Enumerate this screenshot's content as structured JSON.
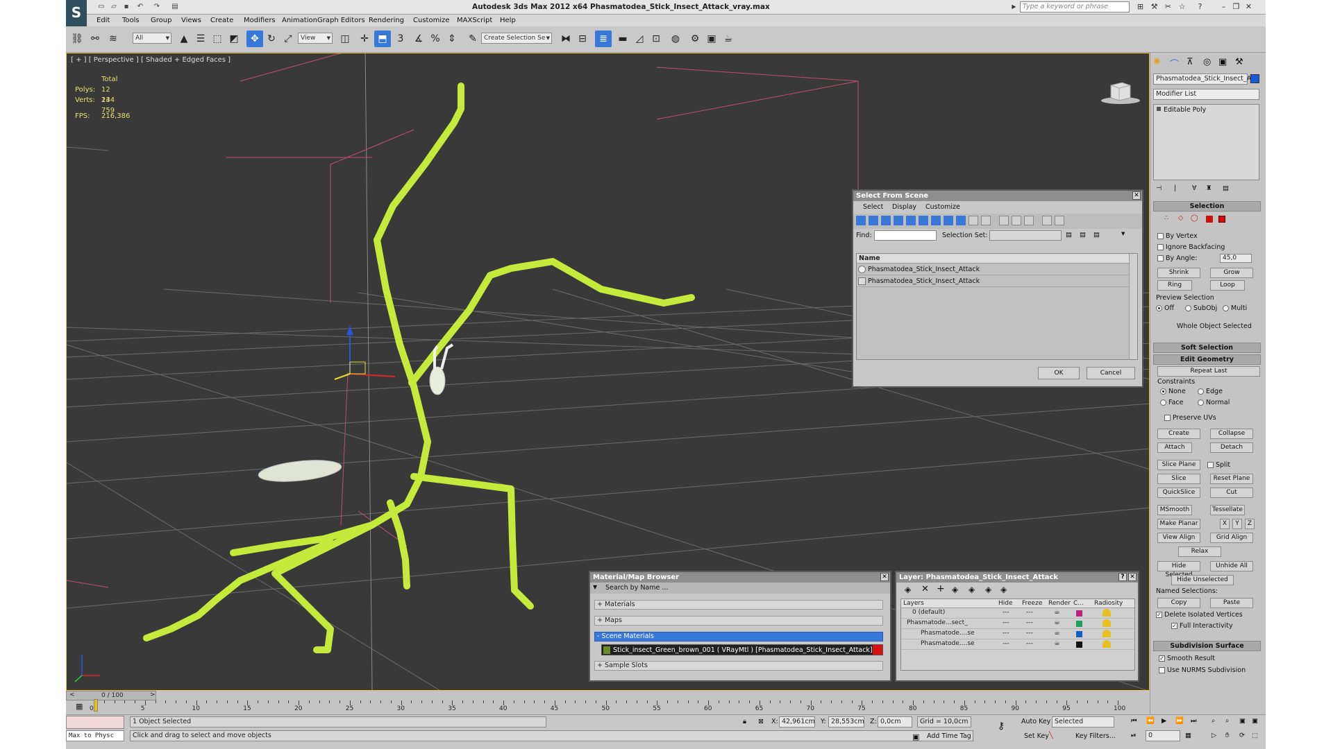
{
  "app": {
    "title": "Autodesk 3ds Max  2012 x64     Phasmatodea_Stick_Insect_Attack_vray.max",
    "search_placeholder": "Type a keyword or phrase"
  },
  "menu": [
    "Edit",
    "Tools",
    "Group",
    "Views",
    "Create",
    "Modifiers",
    "Animation",
    "Graph Editors",
    "Rendering",
    "Customize",
    "MAXScript",
    "Help"
  ],
  "toolbar": {
    "filter": "All",
    "ref_coord": "View",
    "selection_set": "Create Selection Se"
  },
  "viewport": {
    "label": "[ + ] [ Perspective ] [ Shaded + Edged Faces ]",
    "stats": {
      "header": "Total",
      "polys_label": "Polys:",
      "polys": "12 244",
      "verts_label": "Verts:",
      "verts": "13 759",
      "fps_label": "FPS:",
      "fps": "216,386"
    }
  },
  "command_panel": {
    "object_name": "Phasmatodea_Stick_Insect_A",
    "modifier_list": "Modifier List",
    "stack_item": "Editable Poly",
    "selection": {
      "title": "Selection",
      "by_vertex": "By Vertex",
      "ignore_backfacing": "Ignore Backfacing",
      "by_angle": "By Angle:",
      "angle": "45,0",
      "shrink": "Shrink",
      "grow": "Grow",
      "ring": "Ring",
      "loop": "Loop",
      "preview_selection": "Preview Selection",
      "off": "Off",
      "subobj": "SubObj",
      "multi": "Multi",
      "status": "Whole Object Selected"
    },
    "soft_selection": "Soft Selection",
    "edit_geometry": {
      "title": "Edit Geometry",
      "repeat_last": "Repeat Last",
      "constraints": "Constraints",
      "none": "None",
      "edge": "Edge",
      "face": "Face",
      "normal": "Normal",
      "preserve_uvs": "Preserve UVs",
      "create": "Create",
      "collapse": "Collapse",
      "attach": "Attach",
      "detach": "Detach",
      "slice_plane": "Slice Plane",
      "split": "Split",
      "slice": "Slice",
      "reset_plane": "Reset Plane",
      "quickslice": "QuickSlice",
      "cut": "Cut",
      "msmooth": "MSmooth",
      "tessellate": "Tessellate",
      "make_planar": "Make Planar",
      "x": "X",
      "y": "Y",
      "z": "Z",
      "view_align": "View Align",
      "grid_align": "Grid Align",
      "relax": "Relax",
      "hide_selected": "Hide Selected",
      "unhide_all": "Unhide All",
      "hide_unselected": "Hide Unselected",
      "named_selections": "Named Selections:",
      "copy": "Copy",
      "paste": "Paste",
      "delete_isolated": "Delete Isolated Vertices",
      "full_interactivity": "Full Interactivity"
    },
    "subdivision": {
      "title": "Subdivision Surface",
      "smooth_result": "Smooth Result",
      "use_nurms": "Use NURMS Subdivision"
    }
  },
  "select_dialog": {
    "title": "Select From Scene",
    "menus": [
      "Select",
      "Display",
      "Customize"
    ],
    "find_label": "Find:",
    "selection_set_label": "Selection Set:",
    "col_name": "Name",
    "items": [
      "Phasmatodea_Stick_Insect_Attack",
      "Phasmatodea_Stick_Insect_Attack"
    ],
    "ok": "OK",
    "cancel": "Cancel"
  },
  "material_browser": {
    "title": "Material/Map Browser",
    "search": "Search by Name ...",
    "groups": [
      "+ Materials",
      "+ Maps",
      "- Scene Materials"
    ],
    "material": "Stick_insect_Green_brown_001  ( VRayMtl ) [Phasmatodea_Stick_Insect_Attack]",
    "sample_slots": "+ Sample Slots"
  },
  "layer_dialog": {
    "title": "Layer: Phasmatodea_Stick_Insect_Attack",
    "help": "?",
    "columns": [
      "Layers",
      "Hide",
      "Freeze",
      "Render",
      "C...",
      "Radiosity"
    ],
    "rows": [
      "0 (default)",
      "Phasmatode...sect_",
      "Phasmatode....se",
      "Phasmatode....se"
    ],
    "colors": [
      "#c02080",
      "#20a060",
      "#1060c0",
      "#111111"
    ]
  },
  "timeline": {
    "frame": "0 / 100",
    "ticks": [
      "0",
      "5",
      "10",
      "15",
      "20",
      "25",
      "30",
      "35",
      "40",
      "45",
      "50",
      "55",
      "60",
      "65",
      "70",
      "75",
      "80",
      "85",
      "90",
      "95",
      "100"
    ]
  },
  "status": {
    "script": "Max to Physc",
    "selected": "1 Object Selected",
    "prompt": "Click and drag to select and move objects",
    "x_label": "X:",
    "x": "42,961cm",
    "y_label": "Y:",
    "y": "28,553cm",
    "z_label": "Z:",
    "z": "0,0cm",
    "grid": "Grid = 10,0cm",
    "auto_key": "Auto Key",
    "set_key": "Set Key",
    "key_mode": "Selected",
    "key_filters": "Key Filters...",
    "add_time_tag": "Add Time Tag",
    "frame_field": "0"
  }
}
